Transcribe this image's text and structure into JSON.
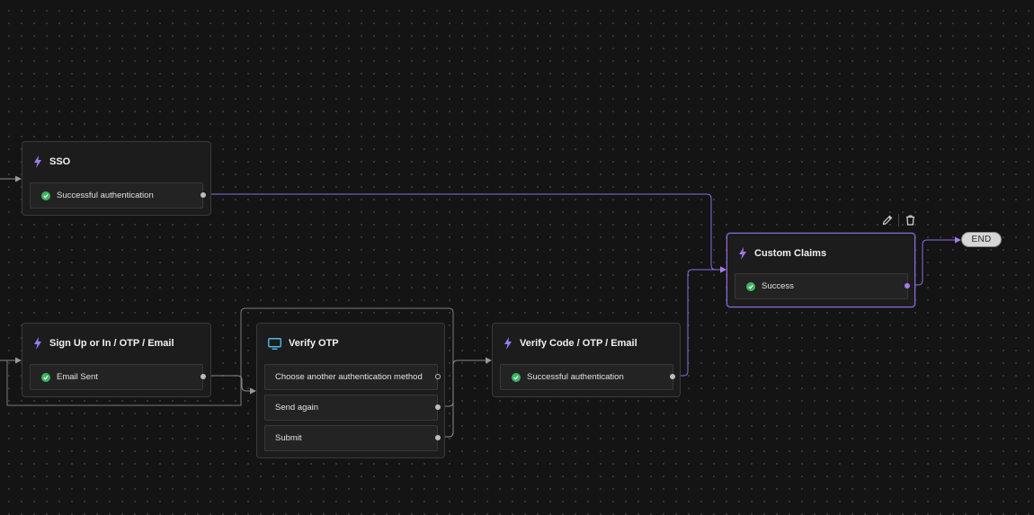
{
  "colors": {
    "canvas_bg": "#141414",
    "node_bg": "#1c1c1c",
    "accent_purple": "#8b6be0",
    "success_green": "#3fb564",
    "screen_blue": "#4fb8e8",
    "edge_gray": "#8a8a8a"
  },
  "nodes": {
    "sso": {
      "icon": "bolt-icon",
      "title": "SSO",
      "outputs": [
        {
          "label": "Successful authentication",
          "icon": "check-circle-icon"
        }
      ]
    },
    "signup": {
      "icon": "bolt-icon",
      "title": "Sign Up or In / OTP / Email",
      "outputs": [
        {
          "label": "Email Sent",
          "icon": "check-circle-icon"
        }
      ]
    },
    "verify_otp": {
      "icon": "screen-icon",
      "title": "Verify OTP",
      "outputs": [
        {
          "label": "Choose another authentication method"
        },
        {
          "label": "Send again"
        },
        {
          "label": "Submit"
        }
      ]
    },
    "verify_code": {
      "icon": "bolt-icon",
      "title": "Verify Code / OTP / Email",
      "outputs": [
        {
          "label": "Successful authentication",
          "icon": "check-circle-icon"
        }
      ]
    },
    "custom_claims": {
      "icon": "bolt-icon",
      "title": "Custom Claims",
      "selected": true,
      "outputs": [
        {
          "label": "Success",
          "icon": "check-circle-icon"
        }
      ]
    },
    "end": {
      "label": "END"
    }
  },
  "toolbar": {
    "edit_icon": "pencil-icon",
    "delete_icon": "trash-icon"
  }
}
